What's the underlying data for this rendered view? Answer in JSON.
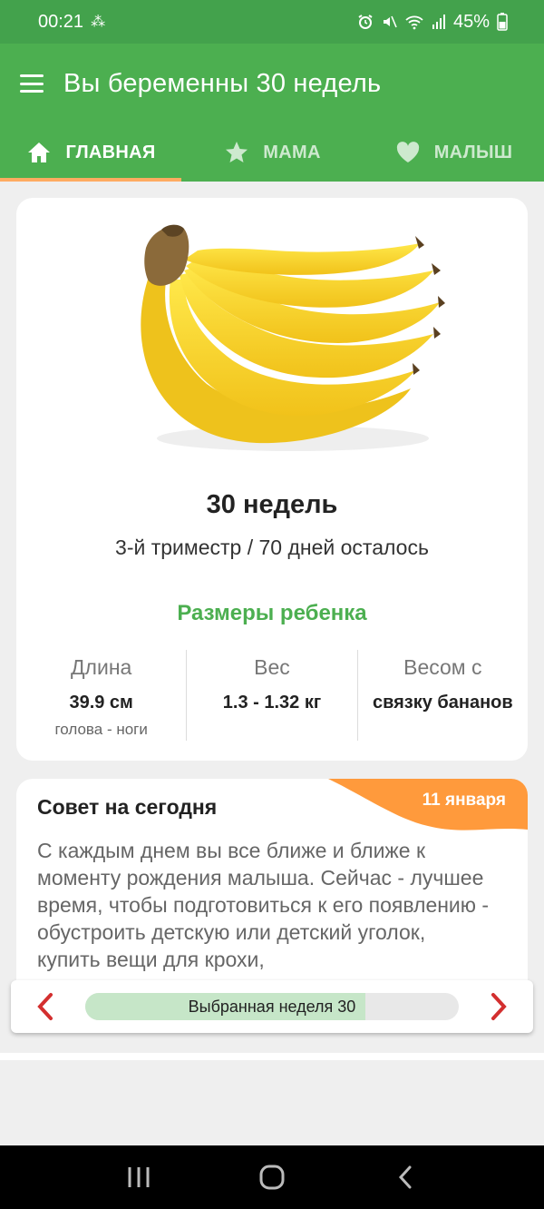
{
  "status_bar": {
    "time": "00:21",
    "battery": "45%",
    "icons": [
      "qr-notification-icon",
      "alarm-icon",
      "mute-icon",
      "wifi-icon",
      "signal-icon",
      "battery-icon"
    ]
  },
  "app_bar": {
    "title": "Вы беременны 30 недель",
    "menu_icon": "hamburger-menu-icon"
  },
  "tabs": [
    {
      "label": "ГЛАВНАЯ",
      "icon": "home-icon",
      "active": true
    },
    {
      "label": "МАМА",
      "icon": "star-icon",
      "active": false
    },
    {
      "label": "МАЛЫШ",
      "icon": "heart-icon",
      "active": false
    }
  ],
  "week_card": {
    "illustration": "banana-bunch",
    "title": "30 недель",
    "subtitle": "3-й триместр / 70 дней осталось",
    "sizes_title": "Размеры ребенка",
    "stats": [
      {
        "label": "Длина",
        "value": "39.9 см",
        "sub": "голова - ноги"
      },
      {
        "label": "Вес",
        "value": "1.3 - 1.32 кг",
        "sub": ""
      },
      {
        "label": "Весом с",
        "value": "связку бананов",
        "sub": ""
      }
    ]
  },
  "tip_card": {
    "title": "Совет на сегодня",
    "date": "11 января",
    "text": "С каждым днем вы все ближе и ближе к моменту рождения малыша. Сейчас - лучшее время, чтобы подготовиться к его появлению - обустроить детскую или детский уголок, купить вещи для крохи,"
  },
  "week_selector": {
    "label": "Выбранная неделя 30",
    "progress_fraction": 0.75,
    "prev_icon": "chevron-left-icon",
    "next_icon": "chevron-right-icon"
  },
  "colors": {
    "primary": "#4caf50",
    "status_bar": "#43a24c",
    "accent": "#ff9a3c",
    "arrow": "#d32f2f"
  }
}
